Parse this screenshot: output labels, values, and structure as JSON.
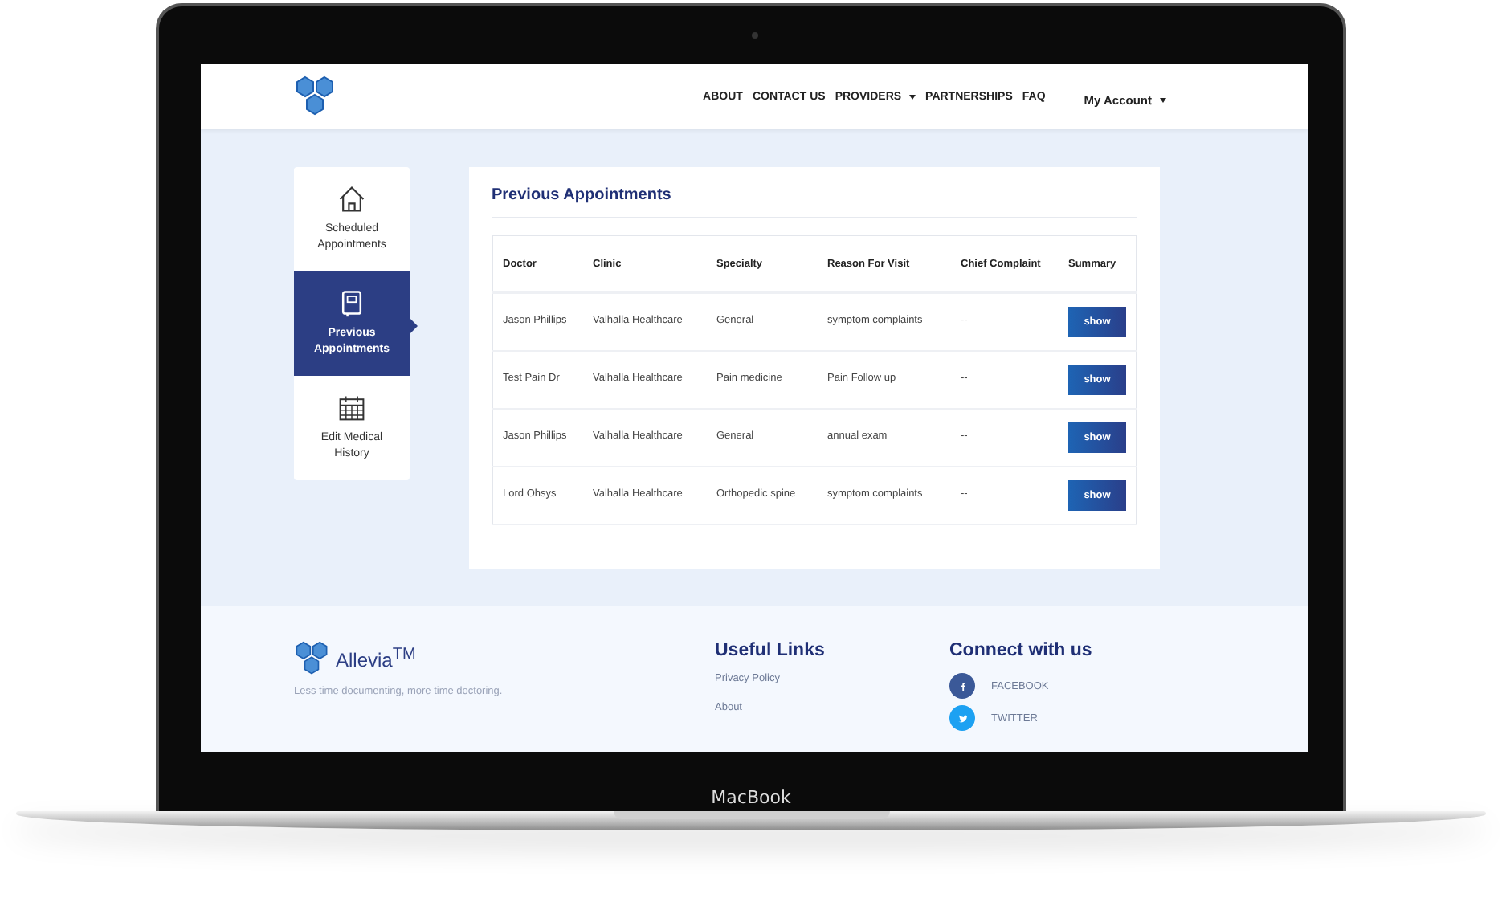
{
  "device_label": "MacBook",
  "nav": {
    "links": [
      {
        "label": "ABOUT",
        "dropdown": false
      },
      {
        "label": "CONTACT US",
        "dropdown": false
      },
      {
        "label": "PROVIDERS",
        "dropdown": true
      },
      {
        "label": "PARTNERSHIPS",
        "dropdown": false
      },
      {
        "label": "FAQ",
        "dropdown": false
      }
    ],
    "account": "My Account"
  },
  "sidebar": {
    "items": [
      {
        "label": "Scheduled Appointments",
        "kind": "home",
        "selected": false
      },
      {
        "label": "Previous Appointments",
        "kind": "notebook",
        "selected": true
      },
      {
        "label": "Edit Medical History",
        "kind": "calendar",
        "selected": false
      }
    ]
  },
  "card": {
    "title": "Previous Appointments",
    "table": {
      "columns": [
        "Doctor",
        "Clinic",
        "Specialty",
        "Reason For Visit",
        "Chief Complaint",
        "Summary"
      ],
      "rows": [
        {
          "doctor": "Jason Phillips",
          "clinic": "Valhalla Healthcare",
          "specialty": "General",
          "reason": "symptom complaints",
          "complaint": "--",
          "action": "show"
        },
        {
          "doctor": "Test Pain Dr",
          "clinic": "Valhalla Healthcare",
          "specialty": "Pain medicine",
          "reason": "Pain Follow up",
          "complaint": "--",
          "action": "show"
        },
        {
          "doctor": "Jason Phillips",
          "clinic": "Valhalla Healthcare",
          "specialty": "General",
          "reason": "annual exam",
          "complaint": "--",
          "action": "show"
        },
        {
          "doctor": "Lord Ohsys",
          "clinic": "Valhalla Healthcare",
          "specialty": "Orthopedic spine",
          "reason": "symptom complaints",
          "complaint": "--",
          "action": "show"
        }
      ]
    }
  },
  "footer": {
    "brand": "Allevia",
    "brand_mark": "TM",
    "tagline": "Less time documenting, more time doctoring.",
    "useful_links": {
      "title": "Useful Links",
      "links": [
        "Privacy Policy",
        "About"
      ]
    },
    "connect": {
      "title": "Connect with us",
      "socials": [
        {
          "label": "FACEBOOK",
          "kind": "facebook",
          "color": "#3b5998"
        },
        {
          "label": "TWITTER",
          "kind": "twitter",
          "color": "#1da1f2"
        }
      ]
    }
  }
}
